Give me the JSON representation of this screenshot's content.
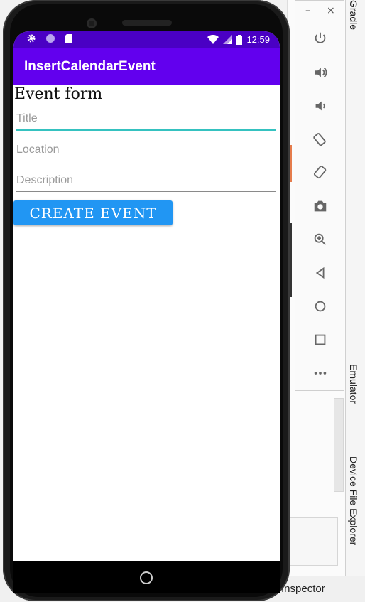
{
  "ide": {
    "gradle_tab": "Gradle",
    "emulator_tab": "Emulator",
    "device_file_explorer_tab": "Device File Explorer",
    "inspector_label": "Inspector"
  },
  "emulator_toolbar": {
    "minimize": "–",
    "close": "×",
    "buttons": [
      "power-icon",
      "volume-up-icon",
      "volume-down-icon",
      "rotate-left-icon",
      "rotate-right-icon",
      "camera-icon",
      "zoom-in-icon",
      "back-icon",
      "home-icon",
      "overview-icon",
      "more-icon"
    ]
  },
  "status_bar": {
    "time": "12:59"
  },
  "app_bar": {
    "title": "InsertCalendarEvent"
  },
  "form": {
    "heading": "Event form",
    "title_placeholder": "Title",
    "location_placeholder": "Location",
    "description_placeholder": "Description",
    "create_button": "CREATE EVENT"
  },
  "colors": {
    "status_bar": "#4a00c4",
    "app_bar": "#6200ee",
    "button": "#2196f3",
    "focus_underline": "#35c2c0"
  }
}
